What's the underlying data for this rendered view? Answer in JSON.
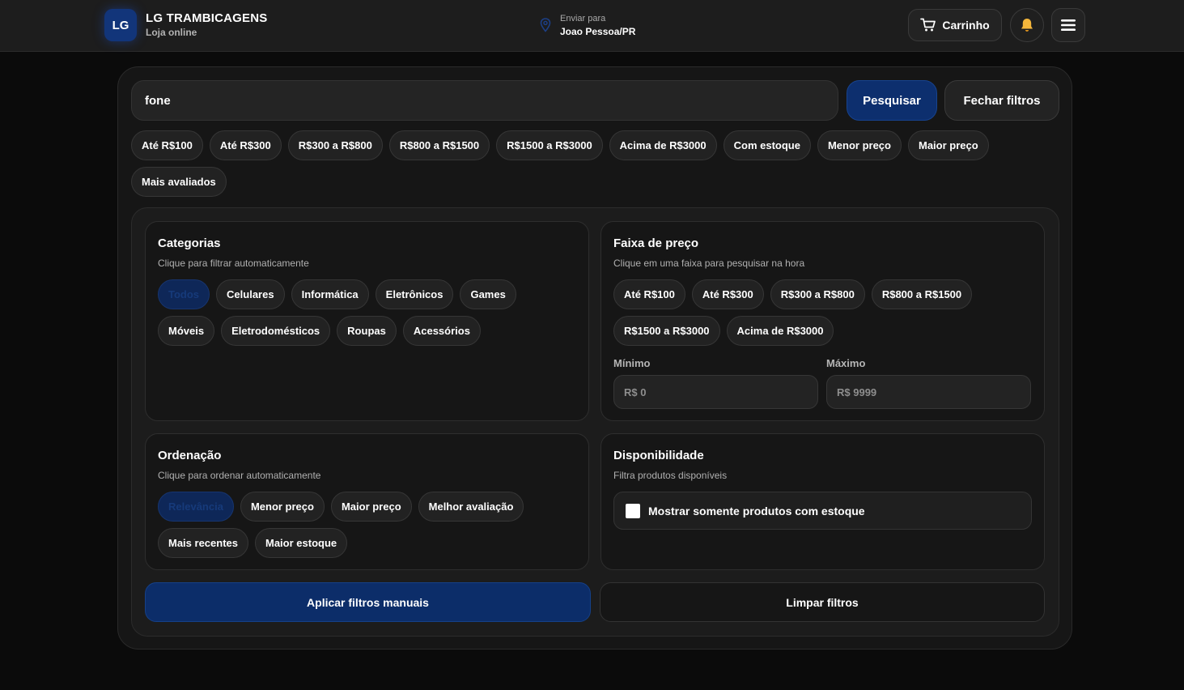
{
  "header": {
    "logo_text": "LG",
    "brand_name": "LG TRAMBICAGENS",
    "brand_sub": "Loja online",
    "location_label": "Enviar para",
    "location_value": "Joao Pessoa/PR",
    "cart_label": "Carrinho",
    "icons": {
      "location": "map-pin-icon",
      "cart": "cart-icon",
      "bell": "bell-icon",
      "menu": "hamburger-icon"
    }
  },
  "search": {
    "value": "fone",
    "submit_label": "Pesquisar",
    "close_label": "Fechar filtros"
  },
  "quick_filters": {
    "row1": [
      "Até R$100",
      "Até R$300",
      "R$300 a R$800",
      "R$800 a R$1500",
      "R$1500 a R$3000",
      "Acima de R$3000",
      "Com estoque",
      "Menor preço",
      "Maior preço"
    ],
    "row2": [
      "Mais avaliados"
    ]
  },
  "categories": {
    "title": "Categorias",
    "subtitle": "Clique para filtrar automaticamente",
    "items": [
      "Todos",
      "Celulares",
      "Informática",
      "Eletrônicos",
      "Games",
      "Móveis",
      "Eletrodomésticos",
      "Roupas",
      "Acessórios"
    ],
    "active": "Todos"
  },
  "price_range": {
    "title": "Faixa de preço",
    "subtitle": "Clique em uma faixa para pesquisar na hora",
    "items": [
      "Até R$100",
      "Até R$300",
      "R$300 a R$800",
      "R$800 a R$1500",
      "R$1500 a R$3000",
      "Acima de R$3000"
    ],
    "min_label": "Mínimo",
    "max_label": "Máximo",
    "min_placeholder": "R$ 0",
    "max_placeholder": "R$ 9999"
  },
  "sorting": {
    "title": "Ordenação",
    "subtitle": "Clique para ordenar automaticamente",
    "items": [
      "Relevância",
      "Menor preço",
      "Maior preço",
      "Melhor avaliação",
      "Mais recentes",
      "Maior estoque"
    ],
    "active": "Relevância"
  },
  "availability": {
    "title": "Disponibilidade",
    "subtitle": "Filtra produtos disponíveis",
    "checkbox_label": "Mostrar somente produtos com estoque",
    "checked": false
  },
  "actions": {
    "apply_label": "Aplicar filtros manuais",
    "clear_label": "Limpar filtros"
  },
  "colors": {
    "accent": "#0c2d69",
    "background": "#0b0b0b",
    "panel": "#161616"
  }
}
